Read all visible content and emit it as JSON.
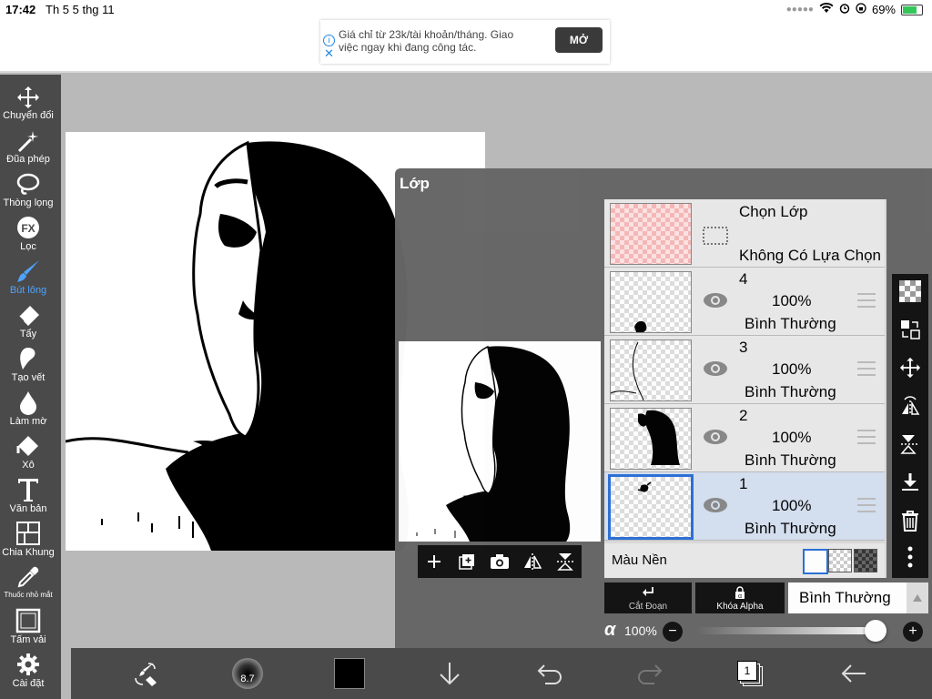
{
  "status": {
    "time": "17:42",
    "date": "Th 5 5 thg 11",
    "battery": "69%"
  },
  "ad": {
    "text": "Giá chỉ từ 23k/tài khoản/tháng. Giao việc ngay khi đang công tác.",
    "button": "MỞ"
  },
  "tools": [
    {
      "label": "Chuyển đổi",
      "icon": "move-icon"
    },
    {
      "label": "Đũa phép",
      "icon": "magic-wand-icon"
    },
    {
      "label": "Thòng lọng",
      "icon": "lasso-icon"
    },
    {
      "label": "Lọc",
      "icon": "fx-icon"
    },
    {
      "label": "Bút lông",
      "icon": "brush-icon",
      "active": true
    },
    {
      "label": "Tẩy",
      "icon": "eraser-icon"
    },
    {
      "label": "Tạo vết",
      "icon": "smudge-icon"
    },
    {
      "label": "Làm mờ",
      "icon": "blur-icon"
    },
    {
      "label": "Xô",
      "icon": "bucket-icon"
    },
    {
      "label": "Văn bản",
      "icon": "text-icon"
    },
    {
      "label": "Chia Khung",
      "icon": "frame-divider-icon"
    },
    {
      "label": "Thuốc nhỏ mắt",
      "icon": "eyedropper-icon"
    },
    {
      "label": "Tấm vải",
      "icon": "canvas-icon"
    },
    {
      "label": "Cài đặt",
      "icon": "gear-icon"
    }
  ],
  "panel": {
    "title": "Lớp",
    "selection_layer": {
      "title": "Chọn Lớp",
      "status": "Không Có Lựa Chọn"
    },
    "layers": [
      {
        "name": "4",
        "opacity": "100%",
        "mode": "Bình Thường",
        "selected": false
      },
      {
        "name": "3",
        "opacity": "100%",
        "mode": "Bình Thường",
        "selected": false
      },
      {
        "name": "2",
        "opacity": "100%",
        "mode": "Bình Thường",
        "selected": false
      },
      {
        "name": "1",
        "opacity": "100%",
        "mode": "Bình Thường",
        "selected": true
      }
    ],
    "background_label": "Màu Nền",
    "clip_label": "Cắt Đoạn",
    "alpha_lock_label": "Khóa Alpha",
    "alpha_lock_symbol": "α",
    "blend_mode": "Bình Thường",
    "alpha_symbol": "α",
    "opacity_value": "100%",
    "opacity_fraction": 1.0
  },
  "bottom": {
    "brush_size": "8.7",
    "page_count": "1",
    "color": "#000000"
  },
  "colors": {
    "accent": "#2a6fd6",
    "toolbar": "#4a4a4a",
    "active_tool": "#4fa3ff"
  }
}
